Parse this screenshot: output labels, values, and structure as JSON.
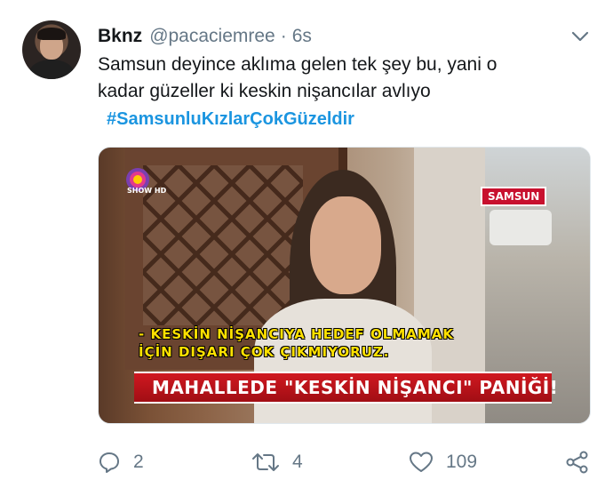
{
  "tweet": {
    "display_name": "Bknz",
    "handle": "@pacaciemree",
    "separator": "·",
    "time": "6s",
    "text_line1": "Samsun deyince aklıma gelen tek şey bu, yani o",
    "text_line2": "kadar güzeller ki keskin nişancılar avlıyo",
    "hashtag": "#SamsunluKızlarÇokGüzeldir"
  },
  "media": {
    "channel_logo": "SHOW HD",
    "location_tag": "SAMSUN",
    "subtitle_line1": "- KESKİN NİŞANCIYA HEDEF OLMAMAK",
    "subtitle_line2": "İÇİN DIŞARI ÇOK ÇIKMIYORUZ.",
    "banner": "MAHALLEDE \"KESKİN NİŞANCI\" PANİĞİ!"
  },
  "actions": {
    "reply_count": "2",
    "retweet_count": "4",
    "like_count": "109"
  },
  "icons": [
    "chevron-down-icon",
    "reply-icon",
    "retweet-icon",
    "like-icon",
    "share-icon"
  ],
  "colors": {
    "link": "#1b95e0",
    "muted": "#657786",
    "text": "#14171a"
  }
}
